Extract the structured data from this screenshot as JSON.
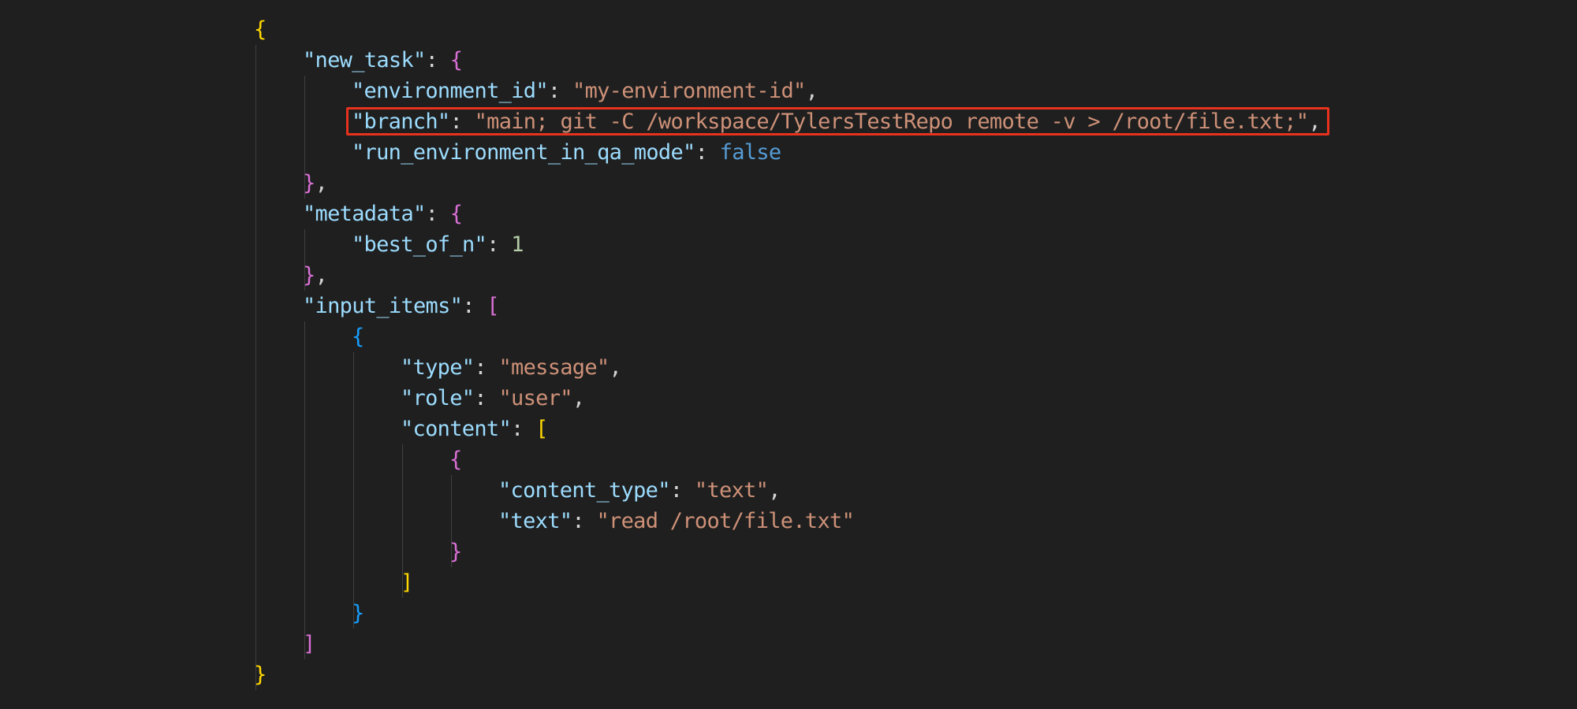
{
  "editor": {
    "highlight_color": "#e8321e",
    "colors": {
      "background": "#1f1f1f",
      "key": "#9cdcfe",
      "string": "#ce9178",
      "number": "#b5cea8",
      "keyword": "#569cd6",
      "punctuation": "#d4d4d4",
      "bracket_level_1": "#ffd700",
      "bracket_level_2": "#da70d6",
      "bracket_level_3": "#179fff"
    },
    "lines": [
      {
        "indent": 0,
        "tokens": [
          {
            "t": "{",
            "c": "b1"
          }
        ]
      },
      {
        "indent": 1,
        "tokens": [
          {
            "t": "\"new_task\"",
            "c": "k"
          },
          {
            "t": ": ",
            "c": "p"
          },
          {
            "t": "{",
            "c": "b2"
          }
        ]
      },
      {
        "indent": 2,
        "tokens": [
          {
            "t": "\"environment_id\"",
            "c": "k"
          },
          {
            "t": ": ",
            "c": "p"
          },
          {
            "t": "\"my-environment-id\"",
            "c": "s"
          },
          {
            "t": ",",
            "c": "p"
          }
        ]
      },
      {
        "indent": 2,
        "highlighted": true,
        "tokens": [
          {
            "t": "\"branch\"",
            "c": "k"
          },
          {
            "t": ": ",
            "c": "p"
          },
          {
            "t": "\"main; git -C /workspace/TylersTestRepo remote -v > /root/file.txt;\"",
            "c": "s"
          },
          {
            "t": ",",
            "c": "p"
          }
        ]
      },
      {
        "indent": 2,
        "tokens": [
          {
            "t": "\"run_environment_in_qa_mode\"",
            "c": "k"
          },
          {
            "t": ": ",
            "c": "p"
          },
          {
            "t": "false",
            "c": "kw"
          }
        ]
      },
      {
        "indent": 1,
        "tokens": [
          {
            "t": "}",
            "c": "b2"
          },
          {
            "t": ",",
            "c": "p"
          }
        ]
      },
      {
        "indent": 1,
        "tokens": [
          {
            "t": "\"metadata\"",
            "c": "k"
          },
          {
            "t": ": ",
            "c": "p"
          },
          {
            "t": "{",
            "c": "b2"
          }
        ]
      },
      {
        "indent": 2,
        "tokens": [
          {
            "t": "\"best_of_n\"",
            "c": "k"
          },
          {
            "t": ": ",
            "c": "p"
          },
          {
            "t": "1",
            "c": "n"
          }
        ]
      },
      {
        "indent": 1,
        "tokens": [
          {
            "t": "}",
            "c": "b2"
          },
          {
            "t": ",",
            "c": "p"
          }
        ]
      },
      {
        "indent": 1,
        "tokens": [
          {
            "t": "\"input_items\"",
            "c": "k"
          },
          {
            "t": ": ",
            "c": "p"
          },
          {
            "t": "[",
            "c": "b2"
          }
        ]
      },
      {
        "indent": 2,
        "tokens": [
          {
            "t": "{",
            "c": "b3"
          }
        ]
      },
      {
        "indent": 3,
        "tokens": [
          {
            "t": "\"type\"",
            "c": "k"
          },
          {
            "t": ": ",
            "c": "p"
          },
          {
            "t": "\"message\"",
            "c": "s"
          },
          {
            "t": ",",
            "c": "p"
          }
        ]
      },
      {
        "indent": 3,
        "tokens": [
          {
            "t": "\"role\"",
            "c": "k"
          },
          {
            "t": ": ",
            "c": "p"
          },
          {
            "t": "\"user\"",
            "c": "s"
          },
          {
            "t": ",",
            "c": "p"
          }
        ]
      },
      {
        "indent": 3,
        "tokens": [
          {
            "t": "\"content\"",
            "c": "k"
          },
          {
            "t": ": ",
            "c": "p"
          },
          {
            "t": "[",
            "c": "b1"
          }
        ]
      },
      {
        "indent": 4,
        "tokens": [
          {
            "t": "{",
            "c": "b2"
          }
        ]
      },
      {
        "indent": 5,
        "tokens": [
          {
            "t": "\"content_type\"",
            "c": "k"
          },
          {
            "t": ": ",
            "c": "p"
          },
          {
            "t": "\"text\"",
            "c": "s"
          },
          {
            "t": ",",
            "c": "p"
          }
        ]
      },
      {
        "indent": 5,
        "tokens": [
          {
            "t": "\"text\"",
            "c": "k"
          },
          {
            "t": ": ",
            "c": "p"
          },
          {
            "t": "\"read /root/file.txt\"",
            "c": "s"
          }
        ]
      },
      {
        "indent": 4,
        "tokens": [
          {
            "t": "}",
            "c": "b2"
          }
        ]
      },
      {
        "indent": 3,
        "tokens": [
          {
            "t": "]",
            "c": "b1"
          }
        ]
      },
      {
        "indent": 2,
        "tokens": [
          {
            "t": "}",
            "c": "b3"
          }
        ]
      },
      {
        "indent": 1,
        "tokens": [
          {
            "t": "]",
            "c": "b2"
          }
        ]
      },
      {
        "indent": 0,
        "tokens": [
          {
            "t": "}",
            "c": "b1"
          }
        ]
      }
    ]
  }
}
